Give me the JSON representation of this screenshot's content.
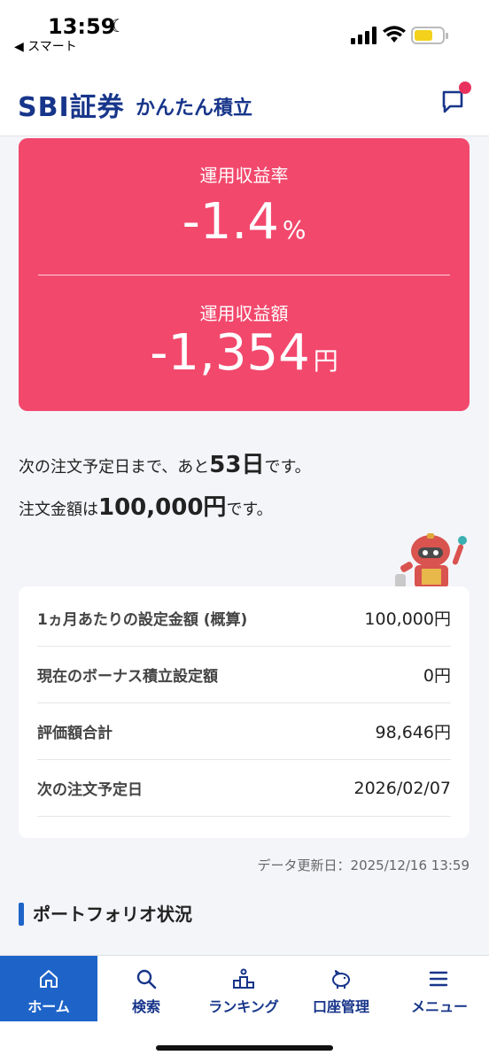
{
  "status_bar": {
    "time": "13:59",
    "back_app": "◀ スマート"
  },
  "header": {
    "logo": "SBI証券",
    "subtitle": "かんたん積立",
    "accent_color": "#17358a",
    "notification_dot_color": "#e8325d"
  },
  "performance": {
    "rate_label": "運用収益率",
    "rate_value": "-1.4",
    "rate_unit": "%",
    "amount_label": "運用収益額",
    "amount_value": "-1,354",
    "amount_unit": "円",
    "card_color": "#f2486c"
  },
  "info": {
    "line1_pre": "次の注文予定日まで、あと",
    "line1_num": "53日",
    "line1_post": "です。",
    "line2_pre": "注文金額は",
    "line2_num": "100,000円",
    "line2_post": "です。"
  },
  "settings": {
    "rows": [
      {
        "label": "1ヵ月あたりの設定金額 (概算)",
        "value": "100,000",
        "unit": "円"
      },
      {
        "label": "現在のボーナス積立設定額",
        "value": "0",
        "unit": "円"
      },
      {
        "label": "評価額合計",
        "value": "98,646",
        "unit": "円"
      },
      {
        "label": "次の注文予定日",
        "value": "2026/02/07",
        "unit": ""
      }
    ]
  },
  "update_note": "データ更新日：2025/12/16 13:59",
  "section_title": "ポートフォリオ状況",
  "nav": {
    "items": [
      {
        "label": "ホーム",
        "icon": "home-icon",
        "active": true
      },
      {
        "label": "検索",
        "icon": "search-icon",
        "active": false
      },
      {
        "label": "ランキング",
        "icon": "ranking-icon",
        "active": false
      },
      {
        "label": "口座管理",
        "icon": "piggy-bank-icon",
        "active": false
      },
      {
        "label": "メニュー",
        "icon": "menu-icon",
        "active": false
      }
    ],
    "active_color": "#1e64c8"
  }
}
